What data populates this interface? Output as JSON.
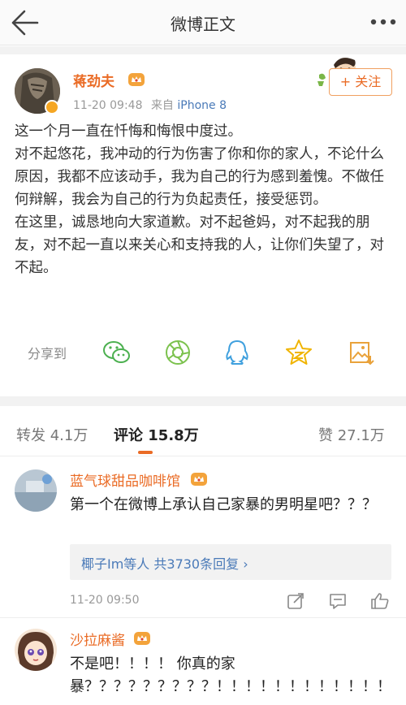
{
  "nav": {
    "title": "微博正文"
  },
  "post": {
    "author": "蒋劲夫",
    "time": "11-20 09:48",
    "source_prefix": "来自",
    "source": "iPhone 8",
    "follow_label": "+ 关注",
    "paragraphs": [
      "这一个月一直在忏悔和悔恨中度过。",
      "对不起悠花，我冲动的行为伤害了你和你的家人，不论什么原因，我都不应该动手，我为自己的行为感到羞愧。不做任何辩解，我会为自己的行为负起责任，接受惩罚。",
      "在这里，诚恳地向大家道歉。对不起爸妈，对不起我的朋友，对不起一直以来关心和支持我的人，让你们失望了，对不起。"
    ]
  },
  "share": {
    "label": "分享到",
    "targets": [
      "wechat-icon",
      "moments-icon",
      "qq-icon",
      "qzone-icon",
      "save-image-icon"
    ]
  },
  "tabs": {
    "repost": "转发 4.1万",
    "comment": "评论 15.8万",
    "like": "赞 27.1万"
  },
  "comments": [
    {
      "name": "蓝气球甜品咖啡馆",
      "text": "第一个在微博上承认自己家暴的男明星吧？？？",
      "replies": "椰子Im等人  共3730条回复 ›",
      "time": "11-20 09:50"
    },
    {
      "name": "沙拉麻酱",
      "text": "不是吧！！！！ 你真的家暴？？？？？？？？？！！！！！！！！！！！！"
    }
  ],
  "colors": {
    "accent": "#ea6b25",
    "link": "#4a7ab8",
    "muted": "#999999"
  }
}
